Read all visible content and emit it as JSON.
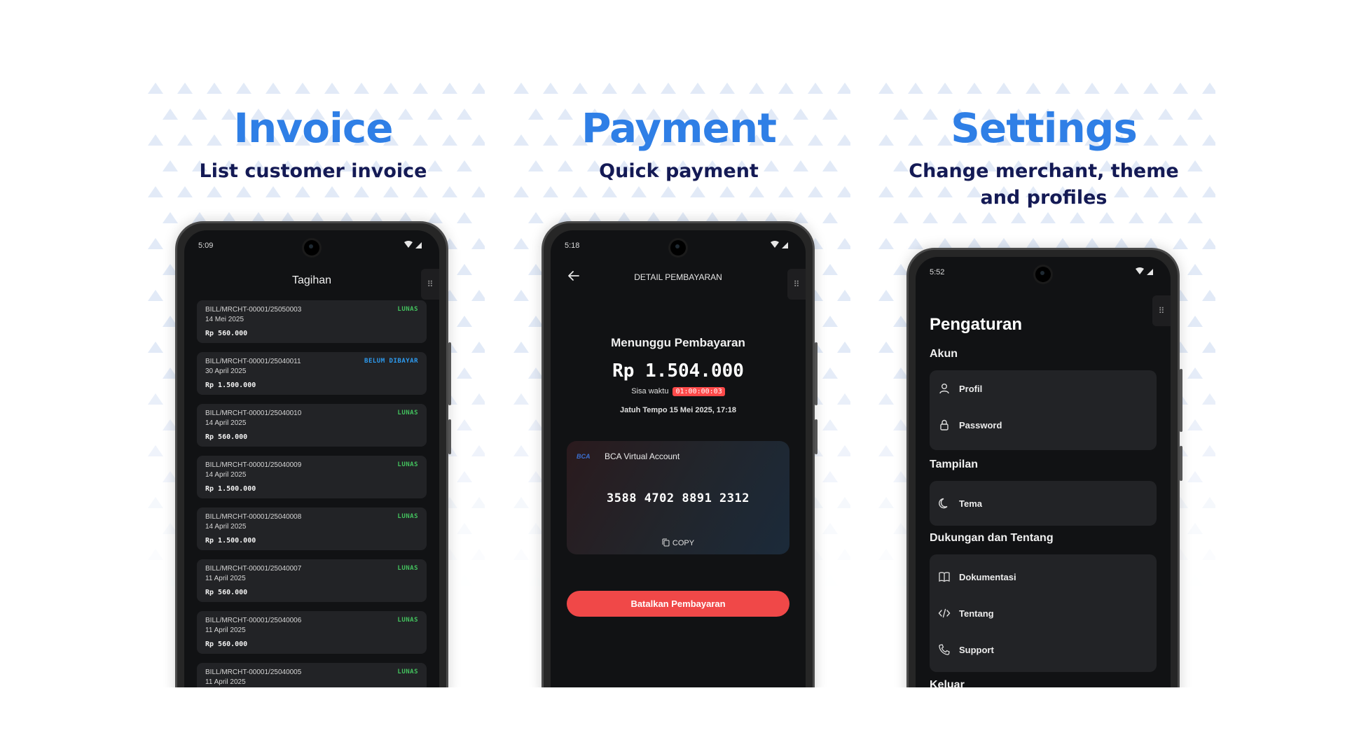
{
  "colors": {
    "title_blue": "#2f7fe6",
    "subtitle_navy": "#141a55",
    "status_green": "#43c25e",
    "status_blue": "#2d9bf0",
    "danger_red": "#f04848"
  },
  "panels": [
    {
      "title": "Invoice",
      "subtitle": "List customer invoice"
    },
    {
      "title": "Payment",
      "subtitle": "Quick payment"
    },
    {
      "title": "Settings",
      "subtitle": "Change merchant, theme and profiles"
    }
  ],
  "invoice": {
    "time": "5:09",
    "header": "Tagihan",
    "bills": [
      {
        "id": "BILL/MRCHT-00001/25050003",
        "date": "14 Mei 2025",
        "amount": "Rp 560.000",
        "status": "LUNAS",
        "paid": true
      },
      {
        "id": "BILL/MRCHT-00001/25040011",
        "date": "30 April 2025",
        "amount": "Rp 1.500.000",
        "status": "BELUM DIBAYAR",
        "paid": false
      },
      {
        "id": "BILL/MRCHT-00001/25040010",
        "date": "14 April 2025",
        "amount": "Rp 560.000",
        "status": "LUNAS",
        "paid": true
      },
      {
        "id": "BILL/MRCHT-00001/25040009",
        "date": "14 April 2025",
        "amount": "Rp 1.500.000",
        "status": "LUNAS",
        "paid": true
      },
      {
        "id": "BILL/MRCHT-00001/25040008",
        "date": "14 April 2025",
        "amount": "Rp 1.500.000",
        "status": "LUNAS",
        "paid": true
      },
      {
        "id": "BILL/MRCHT-00001/25040007",
        "date": "11 April 2025",
        "amount": "Rp 560.000",
        "status": "LUNAS",
        "paid": true
      },
      {
        "id": "BILL/MRCHT-00001/25040006",
        "date": "11 April 2025",
        "amount": "Rp 560.000",
        "status": "LUNAS",
        "paid": true
      },
      {
        "id": "BILL/MRCHT-00001/25040005",
        "date": "11 April 2025",
        "amount": "",
        "status": "LUNAS",
        "paid": true
      }
    ]
  },
  "payment": {
    "time": "5:18",
    "header": "DETAIL PEMBAYARAN",
    "status": "Menunggu Pembayaran",
    "amount": "Rp 1.504.000",
    "remaining_label": "Sisa waktu",
    "remaining_time": "01:00:00:03",
    "due": "Jatuh Tempo 15 Mei 2025, 17:18",
    "bank_logo": "BCA",
    "bank_name": "BCA Virtual Account",
    "va_number": "3588 4702 8891 2312",
    "copy_label": "COPY",
    "cancel_label": "Batalkan Pembayaran"
  },
  "settings": {
    "time": "5:52",
    "title": "Pengaturan",
    "sections": {
      "account": "Akun",
      "display": "Tampilan",
      "support": "Dukungan dan Tentang",
      "logout": "Keluar"
    },
    "items": {
      "profile": "Profil",
      "password": "Password",
      "theme": "Tema",
      "docs": "Dokumentasi",
      "about": "Tentang",
      "support": "Support"
    },
    "icons": [
      "user-icon",
      "lock-icon",
      "moon-icon",
      "book-icon",
      "code-icon",
      "phone-icon"
    ]
  }
}
